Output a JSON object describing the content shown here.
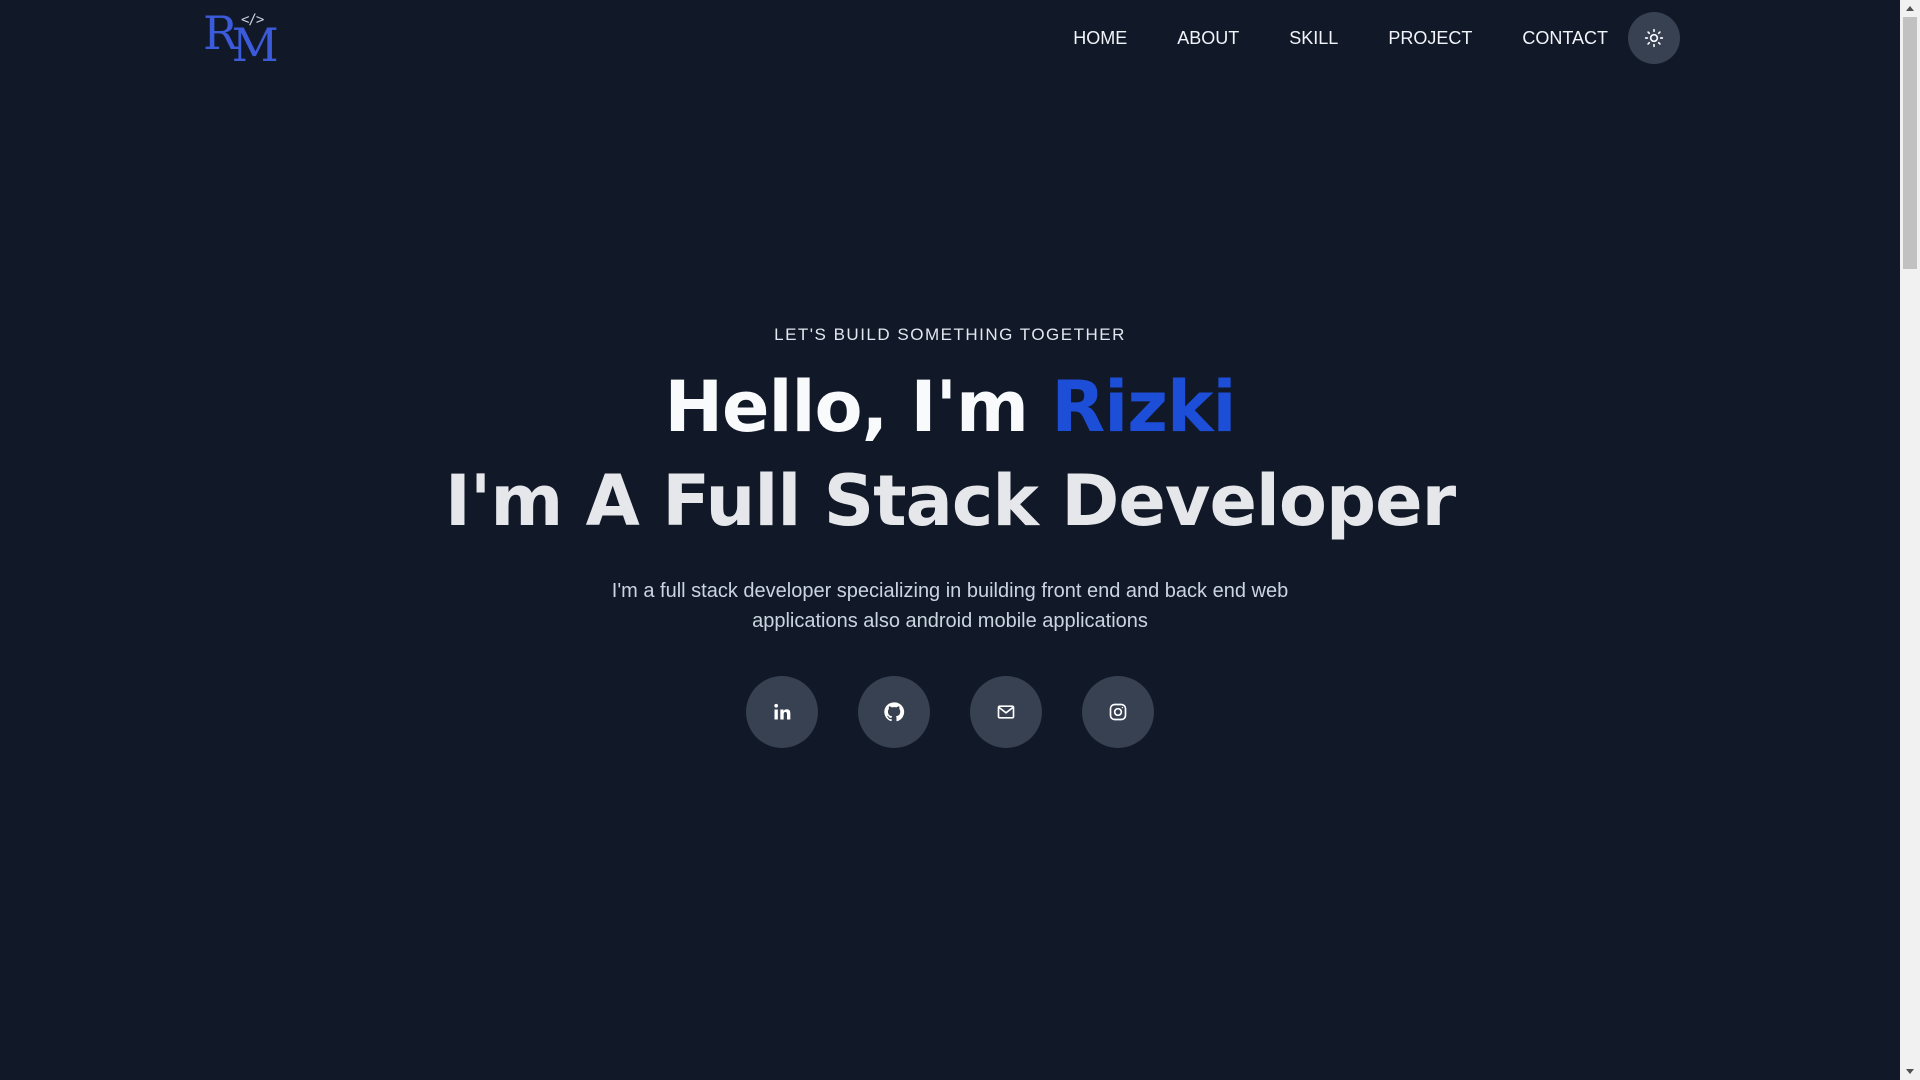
{
  "logo": {
    "letter_r": "R",
    "letter_m": "M",
    "code_mark": "</>"
  },
  "nav": {
    "items": [
      {
        "label": "HOME"
      },
      {
        "label": "ABOUT"
      },
      {
        "label": "SKILL"
      },
      {
        "label": "PROJECT"
      },
      {
        "label": "CONTACT"
      }
    ],
    "theme_toggle_icon": "sun-icon"
  },
  "hero": {
    "tagline": "LET'S BUILD SOMETHING TOGETHER",
    "greeting_prefix": "Hello, I'm ",
    "name": "Rizki",
    "role_line": "I'm A Full Stack Developer",
    "description": "I'm a full stack developer specializing in building front end and back end web applications also android mobile applications"
  },
  "socials": [
    {
      "icon": "linkedin-icon"
    },
    {
      "icon": "github-icon"
    },
    {
      "icon": "mail-icon"
    },
    {
      "icon": "instagram-icon"
    }
  ],
  "colors": {
    "background": "#111827",
    "accent": "#1d4ed8",
    "logo": "#3b5bdb",
    "button_bg": "#374151"
  }
}
